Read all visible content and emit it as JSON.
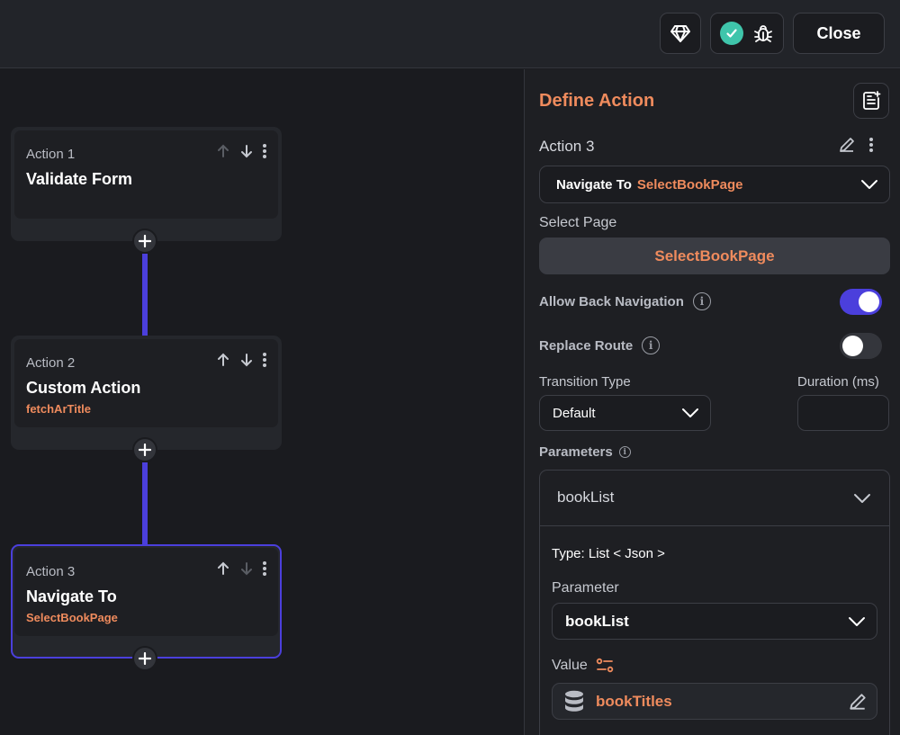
{
  "topbar": {
    "close_label": "Close",
    "icons": [
      "gem-icon",
      "check-icon",
      "bug-icon"
    ]
  },
  "canvas": {
    "actions": [
      {
        "label": "Action 1",
        "title": "Validate Form",
        "subtitle": ""
      },
      {
        "label": "Action 2",
        "title": "Custom Action",
        "subtitle": "fetchArTitle"
      },
      {
        "label": "Action 3",
        "title": "Navigate To",
        "subtitle": "SelectBookPage"
      }
    ]
  },
  "panel": {
    "title": "Define Action",
    "action_name": "Action 3",
    "action_type": {
      "label": "Navigate To",
      "value": "SelectBookPage"
    },
    "select_page": {
      "label": "Select Page",
      "value": "SelectBookPage"
    },
    "allow_back": {
      "label": "Allow Back Navigation",
      "on": true
    },
    "replace_route": {
      "label": "Replace Route",
      "on": false
    },
    "transition": {
      "label": "Transition Type",
      "value": "Default"
    },
    "duration": {
      "label": "Duration (ms)",
      "value": ""
    },
    "parameters": {
      "label": "Parameters",
      "name": "bookList",
      "type_line": "Type: List < Json >",
      "parameter_label": "Parameter",
      "parameter_value": "bookList",
      "value_label": "Value",
      "value": "bookTitles"
    }
  },
  "colors": {
    "accent": "#4b3fdc",
    "orange": "#ef8b5d",
    "success": "#3fc5ab"
  }
}
